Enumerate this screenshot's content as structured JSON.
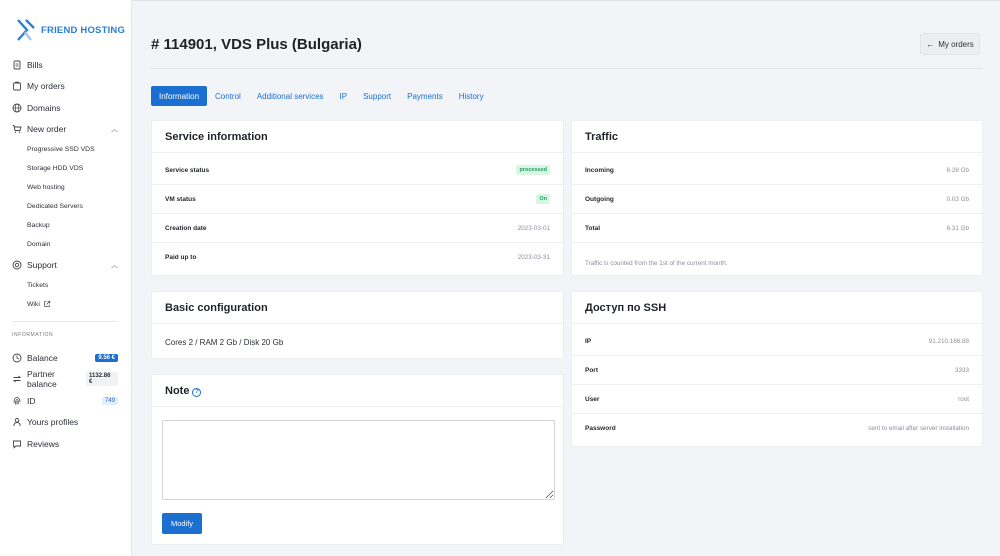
{
  "brand": {
    "name": "FRIEND HOSTING",
    "color": "#2a7fd4"
  },
  "sidebar": {
    "items": [
      {
        "label": "Bills",
        "icon": "document-icon"
      },
      {
        "label": "My orders",
        "icon": "cart-icon"
      },
      {
        "label": "Domains",
        "icon": "globe-icon"
      },
      {
        "label": "New order",
        "icon": "cart-add-icon"
      }
    ],
    "new_order_sub": [
      "Progressive SSD VDS",
      "Storage HDD VDS",
      "Web hosting",
      "Dedicated Servers",
      "Backup",
      "Domain"
    ],
    "support": {
      "label": "Support",
      "icon": "support-icon"
    },
    "support_sub": [
      "Tickets",
      "Wiki"
    ],
    "section_label": "INFORMATION",
    "info_items": [
      {
        "label": "Balance",
        "badge": "9.56 €",
        "icon": "clock-icon"
      },
      {
        "label": "Partner balance",
        "badge": "1132.86 €",
        "icon": "exchange-icon"
      },
      {
        "label": "ID",
        "badge": "749",
        "icon": "fingerprint-icon"
      },
      {
        "label": "Yours profiles",
        "icon": "user-icon"
      },
      {
        "label": "Reviews",
        "icon": "chat-icon"
      }
    ]
  },
  "header": {
    "title": "# 114901, VDS Plus (Bulgaria)",
    "my_orders": "My orders"
  },
  "tabs": [
    "Information",
    "Control",
    "Additional services",
    "IP",
    "Support",
    "Payments",
    "History"
  ],
  "service_info": {
    "title": "Service information",
    "rows": [
      {
        "k": "Service status",
        "v": "processed"
      },
      {
        "k": "VM status",
        "v": "On"
      },
      {
        "k": "Creation date",
        "v": "2023-03-01"
      },
      {
        "k": "Paid up to",
        "v": "2023-03-31"
      }
    ]
  },
  "traffic": {
    "title": "Traffic",
    "rows": [
      {
        "k": "Incoming",
        "v": "6.28 Gb"
      },
      {
        "k": "Outgoing",
        "v": "0.03 Gb"
      },
      {
        "k": "Total",
        "v": "6.31 Gb"
      }
    ],
    "note": "Traffic is counted from the 1st of the current month."
  },
  "basic_config": {
    "title": "Basic configuration",
    "text": "Cores 2 / RAM 2 Gb / Disk 20 Gb"
  },
  "ssh": {
    "title": "Доступ по SSH",
    "rows": [
      {
        "k": "IP",
        "v": "91.210.166.88"
      },
      {
        "k": "Port",
        "v": "3333"
      },
      {
        "k": "User",
        "v": "root"
      },
      {
        "k": "Password",
        "v": "sent to email after server installation"
      }
    ]
  },
  "note": {
    "title": "Note",
    "button": "Modify"
  },
  "colors": {
    "accent": "#1a6fd1",
    "success": "#1fa25a"
  }
}
